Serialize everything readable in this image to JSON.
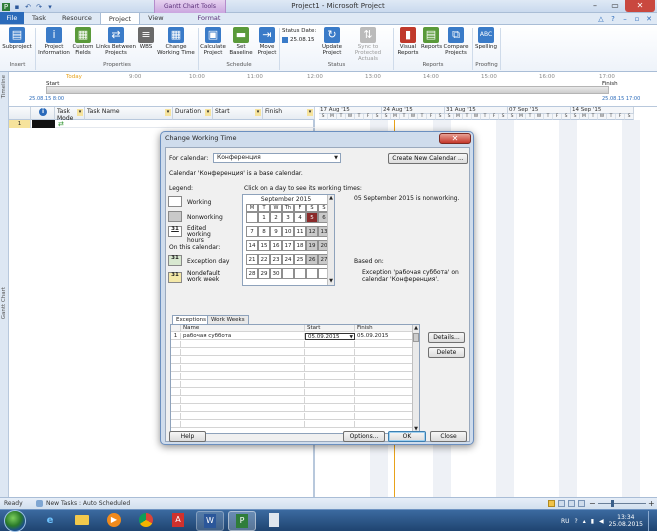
{
  "window": {
    "title": "Project1 - Microsoft Project",
    "context_tab": "Gantt Chart Tools",
    "context_tab_sub": "Format"
  },
  "tabs": [
    "File",
    "Task",
    "Resource",
    "Project",
    "View",
    "Format"
  ],
  "ribbon": {
    "buttons": [
      {
        "label": "Subproject",
        "icon_color": "#3a7bc8"
      },
      {
        "label": "Project Information",
        "icon_color": "#3a7bc8"
      },
      {
        "label": "Custom Fields",
        "icon_color": "#5a9a3a"
      },
      {
        "label": "Links Between Projects",
        "icon_color": "#3a7bc8"
      },
      {
        "label": "WBS",
        "icon_color": "#6a6a6a"
      },
      {
        "label": "Change Working Time",
        "icon_color": "#3a7bc8"
      },
      {
        "label": "Calculate Project",
        "icon_color": "#3a7bc8"
      },
      {
        "label": "Set Baseline",
        "icon_color": "#5a9a3a"
      },
      {
        "label": "Move Project",
        "icon_color": "#3a7bc8"
      },
      {
        "label": "Update Project",
        "icon_color": "#3a7bc8"
      },
      {
        "label": "Sync to Protected Actuals",
        "icon_color": "#999"
      },
      {
        "label": "Visual Reports",
        "icon_color": "#c0392b"
      },
      {
        "label": "Reports",
        "icon_color": "#5a9a3a"
      },
      {
        "label": "Compare Projects",
        "icon_color": "#3a7bc8"
      },
      {
        "label": "Spelling",
        "icon_color": "#3a7bc8"
      }
    ],
    "status_date_label": "Status Date:",
    "status_date_value": "25.08.15",
    "groups": [
      "Insert",
      "Properties",
      "Schedule",
      "Status",
      "Reports",
      "Proofing"
    ]
  },
  "timeline": {
    "side_label": "Timeline",
    "today": "Today",
    "ticks": [
      "9:00",
      "10:00",
      "11:00",
      "12:00",
      "13:00",
      "14:00",
      "15:00",
      "16:00",
      "17:00"
    ],
    "start_label": "Start",
    "start_date": "25.08.15 8:00",
    "finish_label": "Finish",
    "finish_date": "25.08.15 17:00"
  },
  "grid": {
    "side_label": "Gantt Chart",
    "columns": [
      "Task Mode",
      "Task Name",
      "Duration",
      "Start",
      "Finish"
    ],
    "info_icon": "i",
    "row_number": "1"
  },
  "chart": {
    "weeks": [
      "17 Aug '15",
      "24 Aug '15",
      "31 Aug '15",
      "07 Sep '15",
      "14 Sep '15"
    ],
    "days": [
      "S",
      "M",
      "T",
      "W",
      "T",
      "F",
      "S"
    ]
  },
  "dialog": {
    "title": "Change Working Time",
    "for_calendar_label": "For calendar:",
    "for_calendar_value": "Конференция",
    "create_new_calendar": "Create New Calendar ...",
    "base_note": "Calendar 'Конференция' is a base calendar.",
    "legend_title": "Legend:",
    "click_hint": "Click on a day to see its working times:",
    "legend": [
      {
        "label": "Working"
      },
      {
        "label": "Nonworking"
      },
      {
        "label": "Edited working hours",
        "glyph": "31"
      }
    ],
    "on_this_calendar": "On this calendar:",
    "legend2": [
      {
        "label": "Exception day",
        "glyph": "31"
      },
      {
        "label": "Nondefault work week",
        "glyph": "31"
      }
    ],
    "month_title": "September 2015",
    "weekday_headers": [
      "M",
      "T",
      "W",
      "Th",
      "F",
      "S",
      "S"
    ],
    "weeks": [
      [
        "",
        "1",
        "2",
        "3",
        "4",
        "5",
        "6"
      ],
      [
        "7",
        "8",
        "9",
        "10",
        "11",
        "12",
        "13"
      ],
      [
        "14",
        "15",
        "16",
        "17",
        "18",
        "19",
        "20"
      ],
      [
        "21",
        "22",
        "23",
        "24",
        "25",
        "26",
        "27"
      ],
      [
        "28",
        "29",
        "30",
        "",
        "",
        "",
        ""
      ]
    ],
    "info_text": "05 September 2015 is nonworking.",
    "based_on_label": "Based on:",
    "based_on_text": "Exception 'рабочая суббота' on calendar 'Конференция'.",
    "tabs": [
      "Exceptions",
      "Work Weeks"
    ],
    "table_headers": [
      "Name",
      "Start",
      "Finish"
    ],
    "row": {
      "num": "1",
      "name": "рабочая суббота",
      "start": "05.09.2015",
      "finish": "05.09.2015"
    },
    "details": "Details...",
    "delete": "Delete",
    "help": "Help",
    "options": "Options...",
    "ok": "OK",
    "cancel": "Close"
  },
  "status": {
    "ready": "Ready",
    "new_tasks": "New Tasks : Auto Scheduled"
  },
  "taskbar": {
    "lang": "RU",
    "time": "13:34",
    "date": "25.08.2015"
  }
}
